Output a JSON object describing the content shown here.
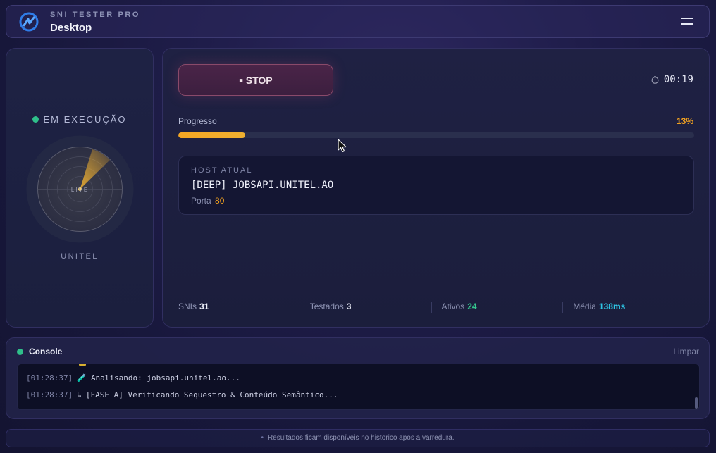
{
  "header": {
    "app_label": "SNI TESTER PRO",
    "window_title": "Desktop",
    "logo_icon": "network-swirl-icon",
    "menu_icon": "hamburger-menu-icon"
  },
  "radar_panel": {
    "status": "EM EXECUÇÃO",
    "radar_label": "LIVE",
    "operator": "UNITEL"
  },
  "main": {
    "stop_label": "STOP",
    "timer": "00:19",
    "progress": {
      "label": "Progresso",
      "percent_text": "13%",
      "value": 0.13
    },
    "host": {
      "title": "HOST ATUAL",
      "name": "[DEEP] JOBSAPI.UNITEL.AO",
      "port_label": "Porta",
      "port_value": "80"
    },
    "stats": [
      {
        "label": "SNIs",
        "value": "31"
      },
      {
        "label": "Testados",
        "value": "3"
      },
      {
        "label": "Ativos",
        "value": "24"
      },
      {
        "label": "Média",
        "value": "138ms"
      }
    ]
  },
  "console": {
    "title": "Console",
    "clear_label": "Limpar",
    "lines": [
      {
        "time": "[01:28:37]",
        "icon": "🧪",
        "text": "Analisando: jobsapi.unitel.ao..."
      },
      {
        "time": "[01:28:37]",
        "icon": "↳",
        "text": "[FASE A] Verificando Sequestro & Conteúdo Semântico..."
      }
    ]
  },
  "footer": {
    "text": "Resultados ficam disponíveis no historico apos a varredura."
  },
  "colors": {
    "accent_orange": "#f0a020",
    "status_green": "#2fbf8a",
    "cyan": "#2ec6e6"
  }
}
